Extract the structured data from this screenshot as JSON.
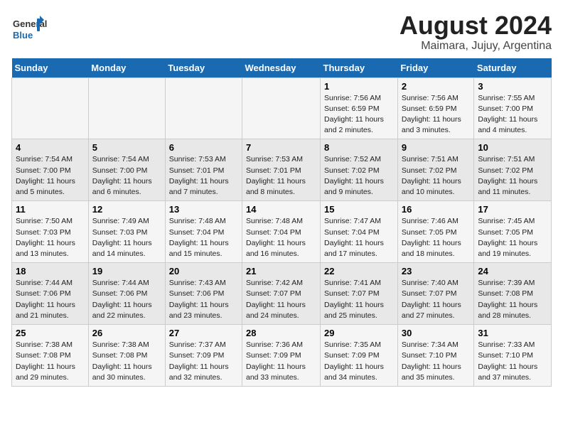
{
  "header": {
    "logo_general": "General",
    "logo_blue": "Blue",
    "title": "August 2024",
    "subtitle": "Maimara, Jujuy, Argentina"
  },
  "weekdays": [
    "Sunday",
    "Monday",
    "Tuesday",
    "Wednesday",
    "Thursday",
    "Friday",
    "Saturday"
  ],
  "weeks": [
    {
      "row_index": 0,
      "days": [
        {
          "day": "",
          "info": ""
        },
        {
          "day": "",
          "info": ""
        },
        {
          "day": "",
          "info": ""
        },
        {
          "day": "",
          "info": ""
        },
        {
          "day": "1",
          "info": "Sunrise: 7:56 AM\nSunset: 6:59 PM\nDaylight: 11 hours\nand 2 minutes."
        },
        {
          "day": "2",
          "info": "Sunrise: 7:56 AM\nSunset: 6:59 PM\nDaylight: 11 hours\nand 3 minutes."
        },
        {
          "day": "3",
          "info": "Sunrise: 7:55 AM\nSunset: 7:00 PM\nDaylight: 11 hours\nand 4 minutes."
        }
      ]
    },
    {
      "row_index": 1,
      "days": [
        {
          "day": "4",
          "info": "Sunrise: 7:54 AM\nSunset: 7:00 PM\nDaylight: 11 hours\nand 5 minutes."
        },
        {
          "day": "5",
          "info": "Sunrise: 7:54 AM\nSunset: 7:00 PM\nDaylight: 11 hours\nand 6 minutes."
        },
        {
          "day": "6",
          "info": "Sunrise: 7:53 AM\nSunset: 7:01 PM\nDaylight: 11 hours\nand 7 minutes."
        },
        {
          "day": "7",
          "info": "Sunrise: 7:53 AM\nSunset: 7:01 PM\nDaylight: 11 hours\nand 8 minutes."
        },
        {
          "day": "8",
          "info": "Sunrise: 7:52 AM\nSunset: 7:02 PM\nDaylight: 11 hours\nand 9 minutes."
        },
        {
          "day": "9",
          "info": "Sunrise: 7:51 AM\nSunset: 7:02 PM\nDaylight: 11 hours\nand 10 minutes."
        },
        {
          "day": "10",
          "info": "Sunrise: 7:51 AM\nSunset: 7:02 PM\nDaylight: 11 hours\nand 11 minutes."
        }
      ]
    },
    {
      "row_index": 2,
      "days": [
        {
          "day": "11",
          "info": "Sunrise: 7:50 AM\nSunset: 7:03 PM\nDaylight: 11 hours\nand 13 minutes."
        },
        {
          "day": "12",
          "info": "Sunrise: 7:49 AM\nSunset: 7:03 PM\nDaylight: 11 hours\nand 14 minutes."
        },
        {
          "day": "13",
          "info": "Sunrise: 7:48 AM\nSunset: 7:04 PM\nDaylight: 11 hours\nand 15 minutes."
        },
        {
          "day": "14",
          "info": "Sunrise: 7:48 AM\nSunset: 7:04 PM\nDaylight: 11 hours\nand 16 minutes."
        },
        {
          "day": "15",
          "info": "Sunrise: 7:47 AM\nSunset: 7:04 PM\nDaylight: 11 hours\nand 17 minutes."
        },
        {
          "day": "16",
          "info": "Sunrise: 7:46 AM\nSunset: 7:05 PM\nDaylight: 11 hours\nand 18 minutes."
        },
        {
          "day": "17",
          "info": "Sunrise: 7:45 AM\nSunset: 7:05 PM\nDaylight: 11 hours\nand 19 minutes."
        }
      ]
    },
    {
      "row_index": 3,
      "days": [
        {
          "day": "18",
          "info": "Sunrise: 7:44 AM\nSunset: 7:06 PM\nDaylight: 11 hours\nand 21 minutes."
        },
        {
          "day": "19",
          "info": "Sunrise: 7:44 AM\nSunset: 7:06 PM\nDaylight: 11 hours\nand 22 minutes."
        },
        {
          "day": "20",
          "info": "Sunrise: 7:43 AM\nSunset: 7:06 PM\nDaylight: 11 hours\nand 23 minutes."
        },
        {
          "day": "21",
          "info": "Sunrise: 7:42 AM\nSunset: 7:07 PM\nDaylight: 11 hours\nand 24 minutes."
        },
        {
          "day": "22",
          "info": "Sunrise: 7:41 AM\nSunset: 7:07 PM\nDaylight: 11 hours\nand 25 minutes."
        },
        {
          "day": "23",
          "info": "Sunrise: 7:40 AM\nSunset: 7:07 PM\nDaylight: 11 hours\nand 27 minutes."
        },
        {
          "day": "24",
          "info": "Sunrise: 7:39 AM\nSunset: 7:08 PM\nDaylight: 11 hours\nand 28 minutes."
        }
      ]
    },
    {
      "row_index": 4,
      "days": [
        {
          "day": "25",
          "info": "Sunrise: 7:38 AM\nSunset: 7:08 PM\nDaylight: 11 hours\nand 29 minutes."
        },
        {
          "day": "26",
          "info": "Sunrise: 7:38 AM\nSunset: 7:08 PM\nDaylight: 11 hours\nand 30 minutes."
        },
        {
          "day": "27",
          "info": "Sunrise: 7:37 AM\nSunset: 7:09 PM\nDaylight: 11 hours\nand 32 minutes."
        },
        {
          "day": "28",
          "info": "Sunrise: 7:36 AM\nSunset: 7:09 PM\nDaylight: 11 hours\nand 33 minutes."
        },
        {
          "day": "29",
          "info": "Sunrise: 7:35 AM\nSunset: 7:09 PM\nDaylight: 11 hours\nand 34 minutes."
        },
        {
          "day": "30",
          "info": "Sunrise: 7:34 AM\nSunset: 7:10 PM\nDaylight: 11 hours\nand 35 minutes."
        },
        {
          "day": "31",
          "info": "Sunrise: 7:33 AM\nSunset: 7:10 PM\nDaylight: 11 hours\nand 37 minutes."
        }
      ]
    }
  ]
}
